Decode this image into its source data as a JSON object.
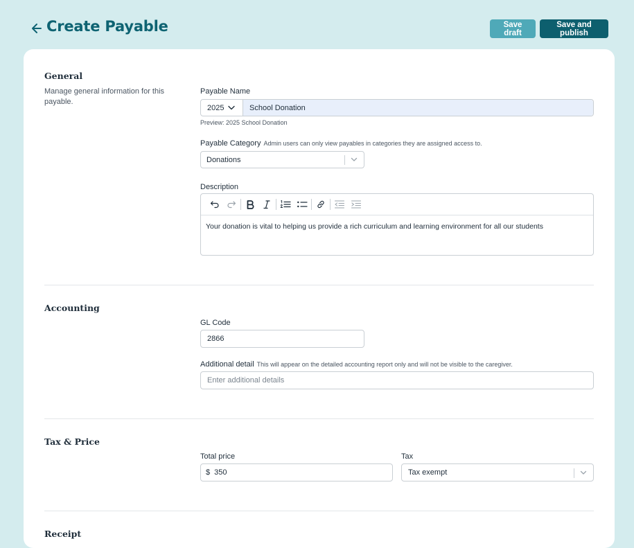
{
  "header": {
    "title": "Create Payable",
    "save_draft": "Save draft",
    "save_publish": "Save and publish"
  },
  "general": {
    "title": "General",
    "description": "Manage general information for this payable.",
    "payable_name_label": "Payable Name",
    "year": "2025",
    "payable_name_value": "School Donation",
    "preview": "Preview: 2025 School Donation",
    "category_label": "Payable Category",
    "category_hint": "Admin users can only view payables in categories they are assigned access to.",
    "category_value": "Donations",
    "description_label": "Description",
    "description_text": "Your donation is vital to helping us provide a rich curriculum and learning environment for all our students"
  },
  "accounting": {
    "title": "Accounting",
    "gl_code_label": "GL Code",
    "gl_code_value": "2866",
    "additional_label": "Additional detail",
    "additional_hint": "This will appear on the detailed accounting report only and will not be visible to the caregiver.",
    "additional_placeholder": "Enter additional details"
  },
  "tax_price": {
    "title": "Tax & Price",
    "total_label": "Total price",
    "currency": "$",
    "total_value": "350",
    "tax_label": "Tax",
    "tax_value": "Tax exempt"
  },
  "next_section": {
    "title": "Receipt"
  },
  "colors": {
    "background": "#d4ecee",
    "accent": "#0e6372",
    "draft_button": "#4fa9b8",
    "publish_button": "#0d5f6e"
  },
  "icons": [
    "arrow-left-icon",
    "chevron-down-icon",
    "undo-icon",
    "redo-icon",
    "bold-icon",
    "italic-icon",
    "numbered-list-icon",
    "bullet-list-icon",
    "link-icon",
    "outdent-icon",
    "indent-icon"
  ]
}
